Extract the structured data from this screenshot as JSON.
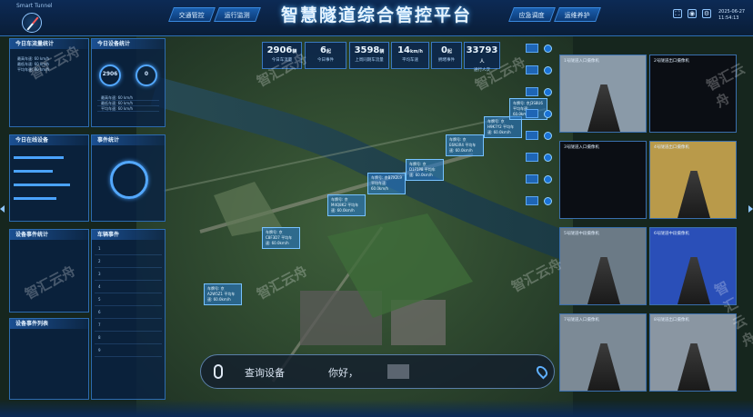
{
  "window": {
    "title": "Smart Tunnel"
  },
  "header": {
    "title": "智慧隧道综合管控平台"
  },
  "nav": {
    "left": [
      "交通管控",
      "运行监测"
    ],
    "right": [
      "应急调度",
      "运维养护"
    ]
  },
  "datetime": {
    "date": "2025-06-27",
    "time": "11:54:13"
  },
  "stats": [
    {
      "value": "2906",
      "unit": "辆",
      "label": "今日车流量"
    },
    {
      "value": "6",
      "unit": "起",
      "label": "今日事件"
    },
    {
      "value": "3598",
      "unit": "辆",
      "label": "上周同期车流量"
    },
    {
      "value": "14",
      "unit": "km/h",
      "label": "平均车速"
    },
    {
      "value": "0",
      "unit": "起",
      "label": "拥堵事件"
    },
    {
      "value": "33793",
      "unit": "人",
      "label": "通行人次"
    }
  ],
  "left_panels": {
    "p1_title": "今日车流量统计",
    "p1_big1": "2906",
    "p1_big2": "0",
    "p1_lines": [
      "最高车速: 60 km/h",
      "最低车速: 60 km/h",
      "平均车速: 60 km/h"
    ],
    "p2_title": "今日设备统计",
    "p3_title": "今日在线设备",
    "p4_title": "事件统计",
    "p5_title": "设备事件统计",
    "p6_title": "车辆事件",
    "p7_title": "设备事件列表",
    "table_rows": [
      "1",
      "2",
      "3",
      "4",
      "5",
      "6",
      "7",
      "8",
      "9"
    ]
  },
  "map_tags": [
    "车牌号: 京C8F3D7 平均车速: 60.0km/h",
    "车牌号: 京A2W5Z1 平均车速: 60.0km/h",
    "车牌号: 京M4Q8K2 平均车速: 60.0km/h",
    "车牌号: 京B7X2L9 平均车速: 60.0km/h",
    "车牌号: 京D1F5P8 平均车速: 60.0km/h",
    "车牌号: 京E6N3R4 平均车速: 60.0km/h",
    "车牌号: 京H9K7Y2 平均车速: 60.0km/h",
    "车牌号: 京J3S8U6 平均车速: 60.0km/h"
  ],
  "cameras": [
    {
      "title": "1号隧道入口摄像机"
    },
    {
      "title": "2号隧道出口摄像机"
    },
    {
      "title": "3号隧道入口摄像机"
    },
    {
      "title": "4号隧道出口摄像机"
    },
    {
      "title": "5号隧道中段摄像机"
    },
    {
      "title": "6号隧道中段摄像机"
    },
    {
      "title": "7号隧道入口摄像机"
    },
    {
      "title": "8号隧道出口摄像机"
    }
  ],
  "search": {
    "placeholder": "查询设备",
    "greeting": "你好，"
  },
  "watermark": "智汇云舟"
}
